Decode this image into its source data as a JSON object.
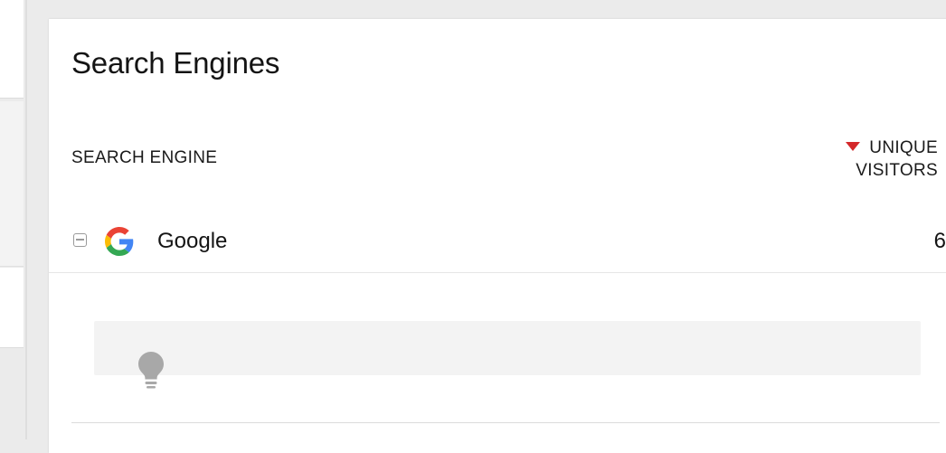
{
  "panel": {
    "title": "Search Engines",
    "columns": {
      "engine": "SEARCH ENGINE",
      "visitors_line1": "UNIQUE",
      "visitors_line2": "VISITORS",
      "sort_direction": "descending",
      "sort_icon": "sort-down-triangle-icon"
    },
    "rows": [
      {
        "name": "Google",
        "icon": "google-icon",
        "expand_state": "expanded",
        "unique_visitors": "6"
      }
    ],
    "tip_icon": "lightbulb-icon"
  },
  "colors": {
    "accent_sort": "#d4282a",
    "google_blue": "#4285F4",
    "google_red": "#EA4335",
    "google_yellow": "#FBBC05",
    "google_green": "#34A853",
    "bulb_grey": "#a8a8a8"
  }
}
